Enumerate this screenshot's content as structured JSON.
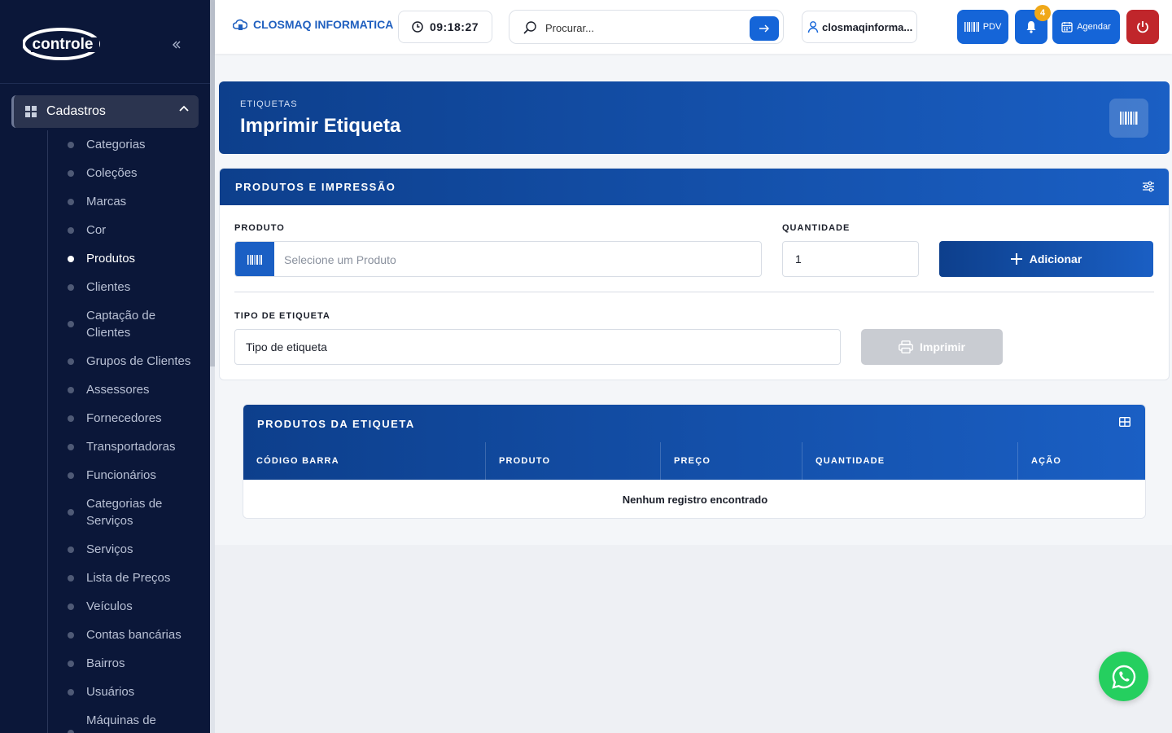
{
  "sidebar": {
    "logo_text": "controle",
    "group_label": "Cadastros",
    "items": [
      {
        "label": "Categorias",
        "active": false
      },
      {
        "label": "Coleções",
        "active": false
      },
      {
        "label": "Marcas",
        "active": false
      },
      {
        "label": "Cor",
        "active": false
      },
      {
        "label": "Produtos",
        "active": true
      },
      {
        "label": "Clientes",
        "active": false
      },
      {
        "label": "Captação de Clientes",
        "active": false
      },
      {
        "label": "Grupos de Clientes",
        "active": false
      },
      {
        "label": "Assessores",
        "active": false
      },
      {
        "label": "Fornecedores",
        "active": false
      },
      {
        "label": "Transportadoras",
        "active": false
      },
      {
        "label": "Funcionários",
        "active": false
      },
      {
        "label": "Categorias de Serviços",
        "active": false
      },
      {
        "label": "Serviços",
        "active": false
      },
      {
        "label": "Lista de Preços",
        "active": false
      },
      {
        "label": "Veículos",
        "active": false
      },
      {
        "label": "Contas bancárias",
        "active": false
      },
      {
        "label": "Bairros",
        "active": false
      },
      {
        "label": "Usuários",
        "active": false
      },
      {
        "label": "Máquinas de",
        "active": false
      }
    ]
  },
  "topbar": {
    "company": "CLOSMAQ INFORMATICA",
    "time": "09:18:27",
    "search_placeholder": "Procurar...",
    "user": "closmaqinforma...",
    "pdv_label": "PDV",
    "notifications_count": "4",
    "agendar_label": "Agendar"
  },
  "hero": {
    "crumb": "ETIQUETAS",
    "title": "Imprimir Etiqueta"
  },
  "form_card": {
    "header": "PRODUTOS E IMPRESSÃO",
    "produto_label": "PRODUTO",
    "produto_placeholder": "Selecione um Produto",
    "quantidade_label": "QUANTIDADE",
    "quantidade_value": "1",
    "add_label": "Adicionar",
    "tipo_label": "TIPO DE ETIQUETA",
    "tipo_value": "Tipo de etiqueta",
    "print_label": "Imprimir"
  },
  "table_card": {
    "header": "PRODUTOS DA ETIQUETA",
    "columns": [
      "CÓDIGO BARRA",
      "PRODUTO",
      "PREÇO",
      "QUANTIDADE",
      "AÇÃO"
    ],
    "empty_text": "Nenhum registro encontrado"
  },
  "colors": {
    "sidebar_bg": "#0b1739",
    "primary": "#1565d8",
    "header_gradient_start": "#0d3f8c",
    "danger": "#c0262b",
    "badge": "#f0a818",
    "whatsapp": "#25cf5f"
  }
}
